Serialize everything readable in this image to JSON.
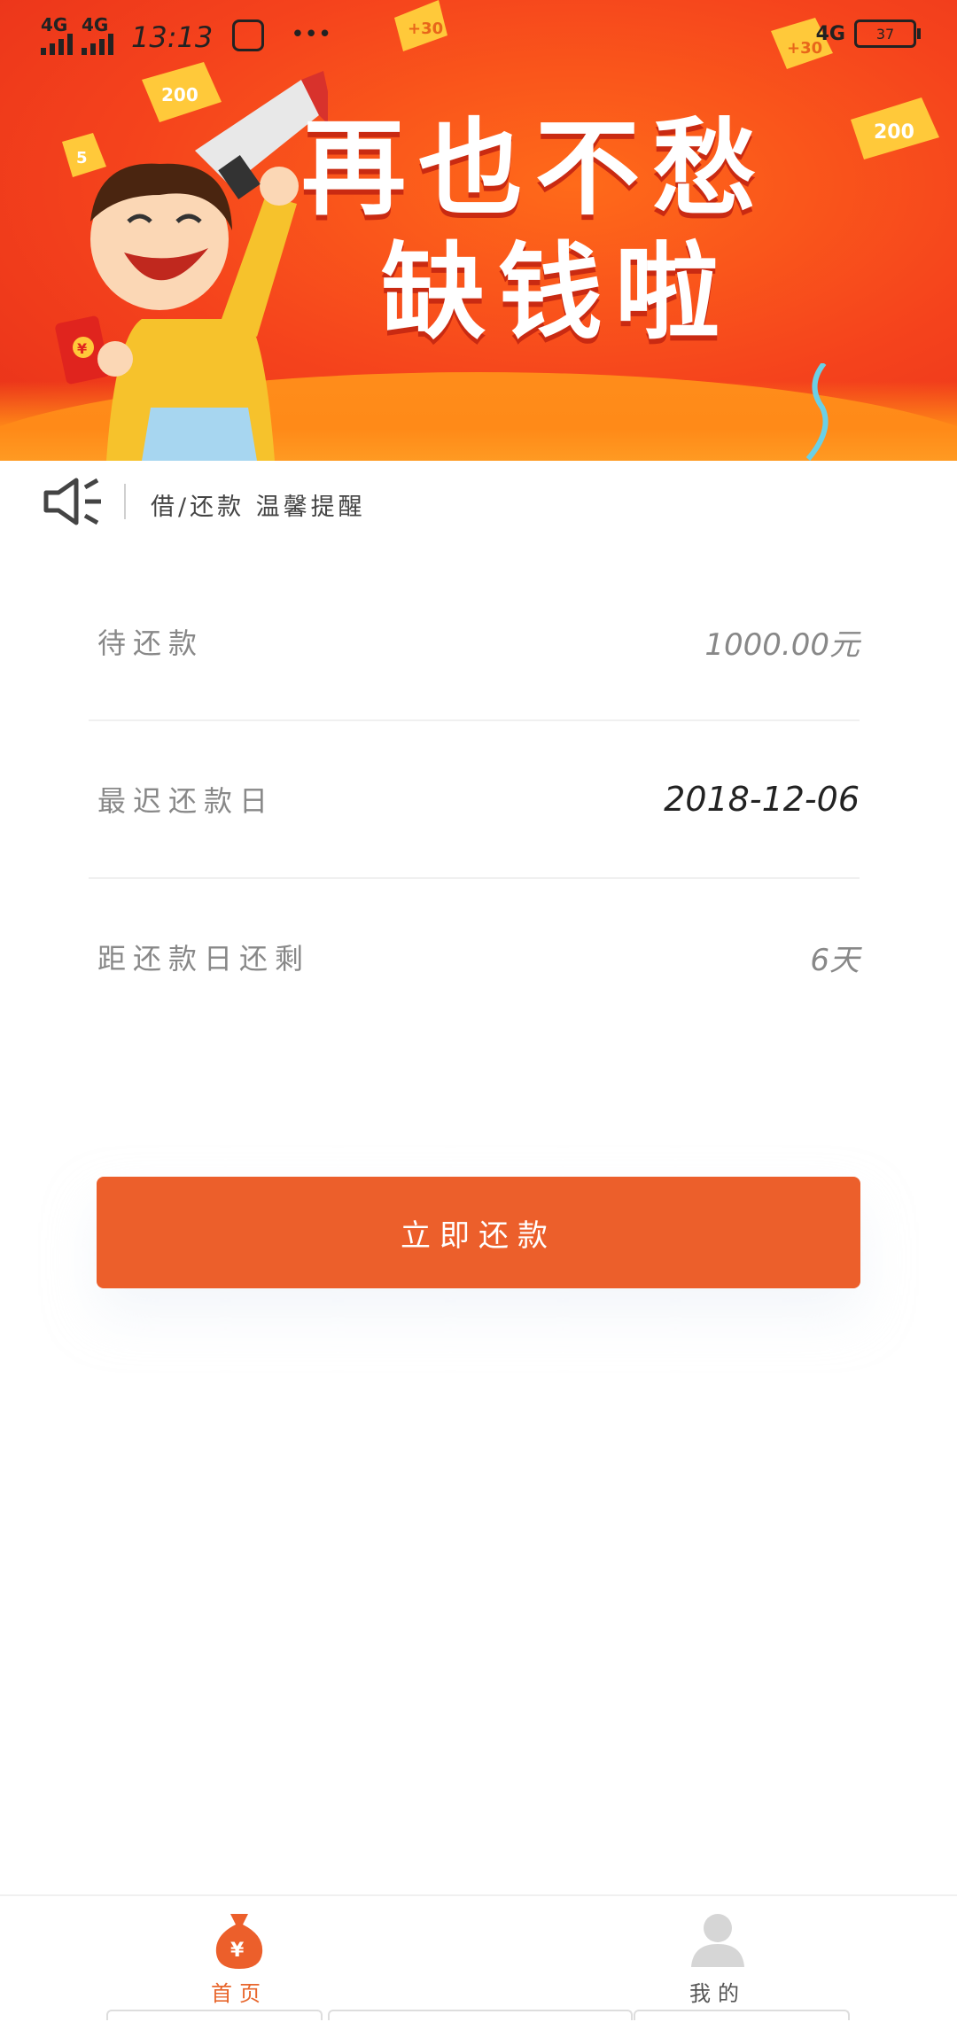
{
  "status_bar": {
    "network_left_1": "4G",
    "network_left_2": "4G",
    "time": "13:13",
    "network_right": "4G",
    "battery": "37"
  },
  "banner": {
    "slogan_line1": "再也不愁",
    "slogan_line2": "缺钱啦",
    "coin_labels": [
      "+30",
      "200",
      "5",
      "+30",
      "200"
    ],
    "red_packet_symbol": "¥"
  },
  "notice": {
    "icon": "speaker-icon",
    "text": "借/还款 温馨提醒"
  },
  "loan_info": {
    "rows": [
      {
        "label": "待还款",
        "value": "1000.00元"
      },
      {
        "label": "最迟还款日",
        "value": "2018-12-06"
      },
      {
        "label": "距还款日还剩",
        "value": "6天"
      }
    ]
  },
  "actions": {
    "repay_label": "立即还款"
  },
  "tabbar": {
    "home_label": "首页",
    "home_icon": "money-bag-icon",
    "home_symbol": "¥",
    "mine_label": "我的",
    "mine_icon": "user-icon"
  },
  "colors": {
    "banner_orange": "#f5431c",
    "accent": "#ec5f2b",
    "active_tab": "#e8662c"
  }
}
